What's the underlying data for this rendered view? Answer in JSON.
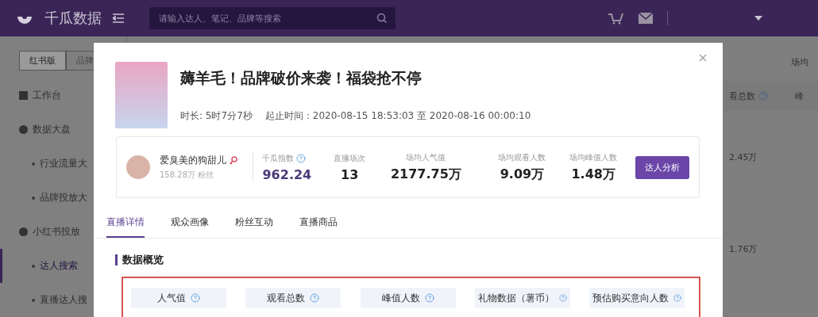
{
  "header": {
    "logo": "千瓜数据",
    "search": {
      "placeholder": "请输入达人、笔记、品牌等搜索"
    }
  },
  "sidebar": {
    "versions": [
      {
        "label": "红书版",
        "selected": true
      },
      {
        "label": "品牌",
        "selected": false
      }
    ],
    "items": [
      {
        "label": "工作台",
        "kind": "group"
      },
      {
        "label": "数据大盘",
        "kind": "group"
      },
      {
        "label": "行业流量大",
        "kind": "sub",
        "selected": false
      },
      {
        "label": "品牌投放大",
        "kind": "sub",
        "selected": false
      },
      {
        "label": "小红书投放",
        "kind": "group"
      },
      {
        "label": "达人搜索",
        "kind": "sub",
        "selected": true
      },
      {
        "label": "直播达人搜",
        "kind": "sub",
        "selected": false
      }
    ]
  },
  "background_table": {
    "column_1": "场均",
    "column_2": "看总数",
    "column_3": "峰",
    "rows": [
      "2.45万",
      "1.76万"
    ]
  },
  "modal": {
    "title": "薅羊毛！品牌破价来袭！福袋抢不停",
    "duration": "时长: 5时7分7秒",
    "period": "起止时间：2020-08-15 18:53:03 至 2020-08-16 00:00:10",
    "author": {
      "name": "爱臭美的狗甜儿",
      "fans": "158.28万 粉丝",
      "button": "达人分析"
    },
    "index": {
      "label": "千瓜指数",
      "value": "962.24"
    },
    "stats": [
      {
        "label": "直播场次",
        "value": "13"
      },
      {
        "label": "场均人气值",
        "value": "2177.75万"
      },
      {
        "label": "场均观看人数",
        "value": "9.09万"
      },
      {
        "label": "场均峰值人数",
        "value": "1.48万"
      }
    ],
    "tabs": [
      {
        "label": "直播详情",
        "selected": true
      },
      {
        "label": "观众画像",
        "selected": false
      },
      {
        "label": "粉丝互动",
        "selected": false
      },
      {
        "label": "直播商品",
        "selected": false
      }
    ],
    "section": "数据概览",
    "overview": [
      "人气值",
      "观看总数",
      "峰值人数",
      "礼物数据（薯币）",
      "预估购买意向人数"
    ]
  }
}
